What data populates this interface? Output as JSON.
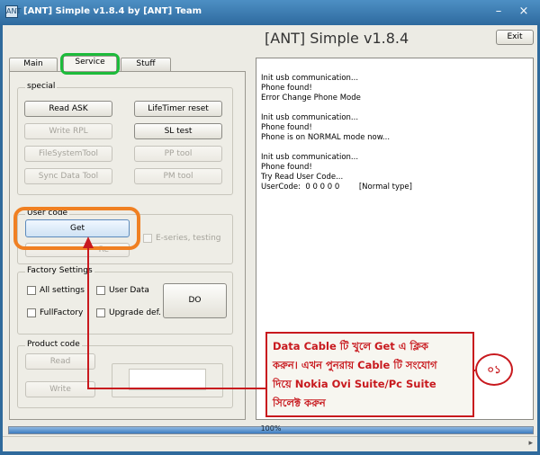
{
  "window": {
    "title": "[ANT] Simple v1.8.4 by [ANT] Team",
    "app_icon": "ANT",
    "minimize_glyph": "–",
    "close_glyph": "×"
  },
  "header": {
    "heading": "[ANT] Simple v1.8.4",
    "exit_label": "Exit"
  },
  "tabs": [
    {
      "label": "Main"
    },
    {
      "label": "Service"
    },
    {
      "label": "Stuff"
    }
  ],
  "special": {
    "label": "special",
    "buttons": [
      {
        "label": "Read ASK",
        "enabled": true
      },
      {
        "label": "LifeTimer reset",
        "enabled": true
      },
      {
        "label": "Write RPL",
        "enabled": false
      },
      {
        "label": "SL test",
        "enabled": true
      },
      {
        "label": "FileSystemTool",
        "enabled": false
      },
      {
        "label": "PP tool",
        "enabled": false
      },
      {
        "label": "Sync Data Tool",
        "enabled": false
      },
      {
        "label": "PM tool",
        "enabled": false
      }
    ]
  },
  "user_code": {
    "label": "User code",
    "get_label": "Get",
    "reset_label": "Re",
    "eseries_label": "E-series, testing"
  },
  "factory": {
    "label": "Factory Settings",
    "all_settings": "All settings",
    "user_data": "User Data",
    "full_factory": "FullFactory",
    "upgrade_def": "Upgrade def.",
    "do_label": "DO"
  },
  "product_code": {
    "label": "Product code",
    "read_label": "Read",
    "write_label": "Write"
  },
  "log": {
    "lines": [
      "Init usb communication...",
      "Phone found!",
      "Error Change Phone Mode",
      "",
      "Init usb communication...",
      "Phone found!",
      "Phone is on NORMAL mode now...",
      "",
      "Init usb communication...",
      "Phone found!",
      "Try Read User Code...",
      "UserCode:  0 0 0 0 0        [Normal type]"
    ]
  },
  "progress": {
    "text": "100%",
    "value": 100
  },
  "annotation": {
    "callout_lines": [
      "Data Cable টি খুলে Get এ ক্লিক",
      "করুন। এখন পুনরায় Cable টি সংযোগ",
      "দিয়ে Nokia Ovi Suite/Pc Suite",
      "সিলেক্ট করুন"
    ],
    "step_number": "০১",
    "color": "#c8191e",
    "ring_color": "#f08022",
    "tab_highlight_color": "#1dbb3b"
  }
}
